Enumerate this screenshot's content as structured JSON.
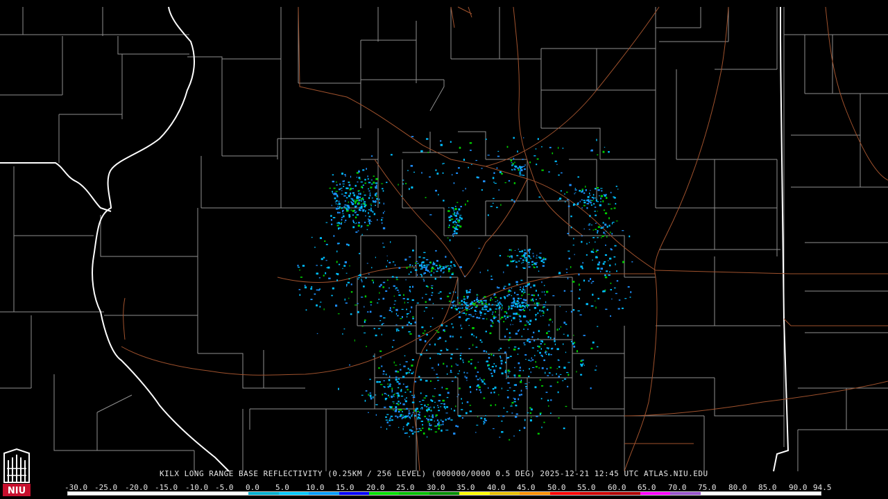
{
  "caption": "KILX LONG RANGE BASE REFLECTIVITY (0.25KM / 256 LEVEL) (000000/0000 0.5 DEG) 2025-12-21 12:45 UTC  ATLAS.NIU.EDU",
  "logo_text": "NIU",
  "scale": {
    "labels": [
      "-30.0",
      "-25.0",
      "-20.0",
      "-15.0",
      "-10.0",
      "-5.0",
      "0.0",
      "5.0",
      "10.0",
      "15.0",
      "20.0",
      "25.0",
      "30.0",
      "35.0",
      "40.0",
      "45.0",
      "50.0",
      "55.0",
      "60.0",
      "65.0",
      "70.0",
      "75.0",
      "80.0",
      "85.0",
      "90.0",
      "94.5"
    ],
    "colors": [
      "#ffffff",
      "#ffffff",
      "#ffffff",
      "#ffffff",
      "#ffffff",
      "#ffffff",
      "#00b0d0",
      "#00c8ff",
      "#009cff",
      "#0000ff",
      "#00e000",
      "#00c000",
      "#009000",
      "#ffff00",
      "#e8c000",
      "#ff9000",
      "#ff0000",
      "#d00000",
      "#b00000",
      "#ff00ff",
      "#9955cc",
      "#ffffff",
      "#ffffff",
      "#ffffff",
      "#ffffff"
    ]
  },
  "colors": {
    "background": "#000000",
    "county_lines": "#8f8f8f",
    "state_lines": "#ffffff",
    "highways": "#a0522d",
    "echo_low": "#1e90ff",
    "echo_mid": "#00bfff",
    "echo_high": "#00d000"
  },
  "radar_site": "KILX"
}
